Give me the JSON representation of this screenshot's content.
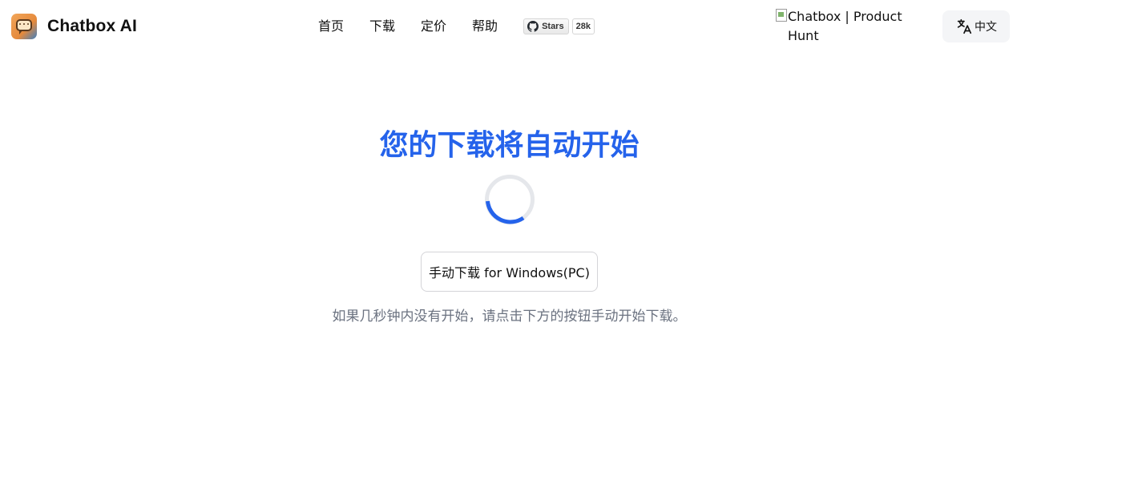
{
  "header": {
    "brand_name": "Chatbox AI",
    "nav": [
      {
        "label": "首页"
      },
      {
        "label": "下载"
      },
      {
        "label": "定价"
      },
      {
        "label": "帮助"
      }
    ],
    "github_badge": {
      "label": "Stars",
      "count": "28k"
    },
    "product_hunt_alt": "Chatbox | Product Hunt",
    "language_button": "中文"
  },
  "main": {
    "title": "您的下载将自动开始",
    "manual_download_button": "手动下载 for Windows(PC)",
    "hint": "如果几秒钟内没有开始，请点击下方的按钮手动开始下载。"
  },
  "colors": {
    "accent": "#2563eb",
    "hint_text": "#6b7280",
    "spinner_track": "#e5e7eb"
  }
}
